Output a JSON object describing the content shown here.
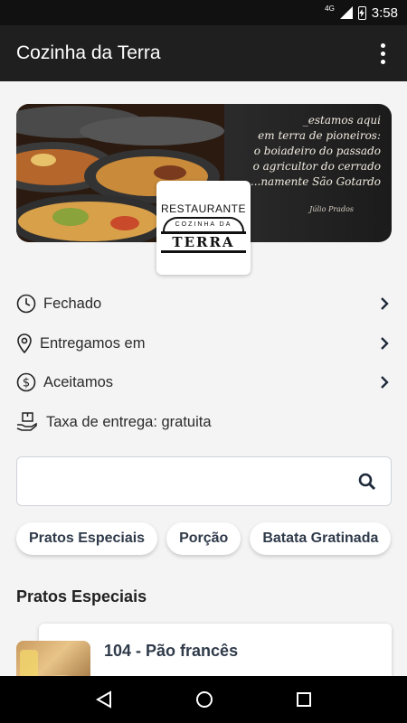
{
  "status_bar": {
    "network": "4G",
    "time": "3:58"
  },
  "app_bar": {
    "title": "Cozinha da Terra"
  },
  "banner": {
    "quote_lines": [
      "_estamos aqui",
      "em terra de pioneiros:",
      "o boiadeiro do passado",
      "o agricultor do cerrado",
      "...namente São Gotardo"
    ],
    "author": "Júlio Prados"
  },
  "logo": {
    "line1": "RESTAURANTE",
    "arc": "COZINHA DA",
    "line2": "TERRA"
  },
  "info": {
    "hours": "Fechado",
    "delivery_area": "Entregamos em",
    "payment": "Aceitamos",
    "fee": "Taxa de entrega: gratuita"
  },
  "search": {
    "placeholder": "",
    "value": ""
  },
  "categories": [
    "Pratos Especiais",
    "Porção",
    "Batata Gratinada"
  ],
  "section_title": "Pratos Especiais",
  "items": [
    {
      "name": "104 - Pão francês"
    }
  ],
  "colors": {
    "app_bar": "#1f1f1f",
    "text_dark": "#2f3a4a",
    "accent_icon": "#1e2a3a"
  }
}
